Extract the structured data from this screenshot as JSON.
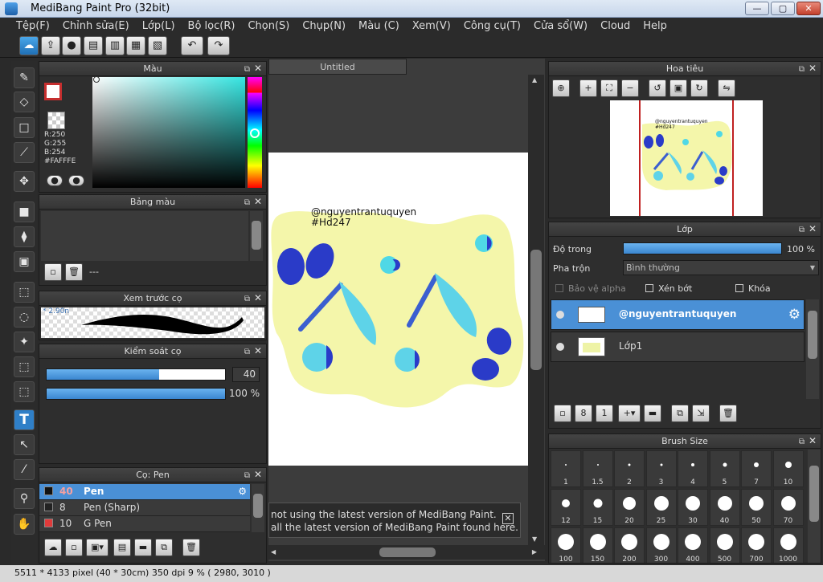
{
  "window": {
    "title": "MediBang Paint Pro (32bit)",
    "min": "—",
    "max": "▢",
    "close": "✕"
  },
  "menu": [
    "Tệp(F)",
    "Chỉnh sửa(E)",
    "Lớp(L)",
    "Bộ lọc(R)",
    "Chọn(S)",
    "Chụp(N)",
    "Màu (C)",
    "Xem(V)",
    "Công cụ(T)",
    "Cửa sổ(W)",
    "Cloud",
    "Help"
  ],
  "toolbar_icons": [
    "cloud-icon",
    "share-icon",
    "comment-icon",
    "message-icon",
    "page-icon",
    "tile-icon",
    "check-list-icon",
    "undo-icon",
    "redo-icon"
  ],
  "color_panel": {
    "title": "Màu",
    "r": "R:250",
    "g": "G:255",
    "b": "B:254",
    "hex": "#FAFFFE",
    "accent": "#FAFFFE"
  },
  "palette_panel": {
    "title": "Bảng màu",
    "value": "---"
  },
  "brush_preview_panel": {
    "title": "Xem trước cọ",
    "size": "* 2.90n"
  },
  "brush_control_panel": {
    "title": "Kiểm soát cọ",
    "size_value": "40",
    "opacity_value": "100 %",
    "size_fraction": 0.63,
    "opacity_fraction": 1.0
  },
  "brush_list_panel": {
    "title": "Cọ: Pen",
    "items": [
      {
        "size": "40",
        "name": "Pen",
        "color": "#111111",
        "selected": true
      },
      {
        "size": "8",
        "name": "Pen (Sharp)",
        "color": "#222222",
        "selected": false
      },
      {
        "size": "10",
        "name": "G Pen",
        "color": "#e03a3a",
        "selected": false
      }
    ]
  },
  "canvas": {
    "tab": "Untitled",
    "watermark_user": "@nguyentrantuquyen",
    "watermark_tag": "#Hd247"
  },
  "notice": {
    "line1": "not using the latest version of MediBang Paint.",
    "line2": "all the latest version of MediBang Paint found here.",
    "close": "✕"
  },
  "navigator_panel": {
    "title": "Hoa tiêu",
    "user": "@nguyentrantuquyen",
    "tag": "#Hd247"
  },
  "layer_panel": {
    "title": "Lớp",
    "opacity_label": "Độ trong",
    "opacity_value": "100 %",
    "opacity_fraction": 1.0,
    "blend_label": "Pha trộn",
    "blend_value": "Bình thường",
    "protect_alpha": "Bảo vệ alpha",
    "clip": "Xén bớt",
    "lock": "Khóa",
    "layers": [
      {
        "name": "@nguyentrantuquyen",
        "selected": true
      },
      {
        "name": "Lớp1",
        "selected": false
      }
    ]
  },
  "brush_size_panel": {
    "title": "Brush Size",
    "sizes": [
      "1",
      "1.5",
      "2",
      "3",
      "4",
      "5",
      "7",
      "10",
      "12",
      "15",
      "20",
      "25",
      "30",
      "40",
      "50",
      "70",
      "100",
      "150",
      "200",
      "300",
      "400",
      "500",
      "700",
      "1000"
    ]
  },
  "status": {
    "text": "5511 * 4133 pixel   (40 * 30cm)   350 dpi   9 %   ( 2980, 3010 )"
  }
}
